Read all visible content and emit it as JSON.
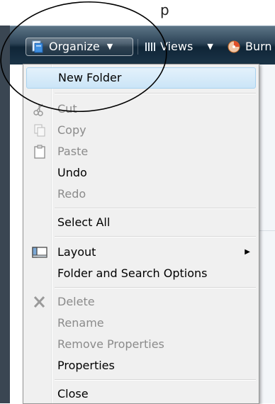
{
  "background": {
    "partial_text": "p"
  },
  "toolbar": {
    "organize_label": "Organize",
    "views_label": "Views",
    "burn_label": "Burn",
    "organize_icon": "organize-folder-icon",
    "views_icon": "views-list-icon",
    "burn_icon": "burn-disc-icon"
  },
  "menu": {
    "items": [
      {
        "label": "New Folder",
        "enabled": true,
        "highlighted": true
      },
      {
        "label": "Cut",
        "enabled": false,
        "icon": "scissors-icon"
      },
      {
        "label": "Copy",
        "enabled": false,
        "icon": "copy-icon"
      },
      {
        "label": "Paste",
        "enabled": false,
        "icon": "clipboard-icon"
      },
      {
        "label": "Undo",
        "enabled": true
      },
      {
        "label": "Redo",
        "enabled": false
      },
      {
        "label": "Select All",
        "enabled": true
      },
      {
        "label": "Layout",
        "enabled": true,
        "icon": "layout-icon",
        "has_submenu": true
      },
      {
        "label": "Folder and Search Options",
        "enabled": true
      },
      {
        "label": "Delete",
        "enabled": false,
        "icon": "delete-x-icon"
      },
      {
        "label": "Rename",
        "enabled": false
      },
      {
        "label": "Remove Properties",
        "enabled": false
      },
      {
        "label": "Properties",
        "enabled": true
      },
      {
        "label": "Close",
        "enabled": true
      }
    ]
  },
  "colors": {
    "toolbar_dark": "#0f2537",
    "highlight": "#cbe5f7",
    "disabled_text": "#8b8b8b"
  }
}
